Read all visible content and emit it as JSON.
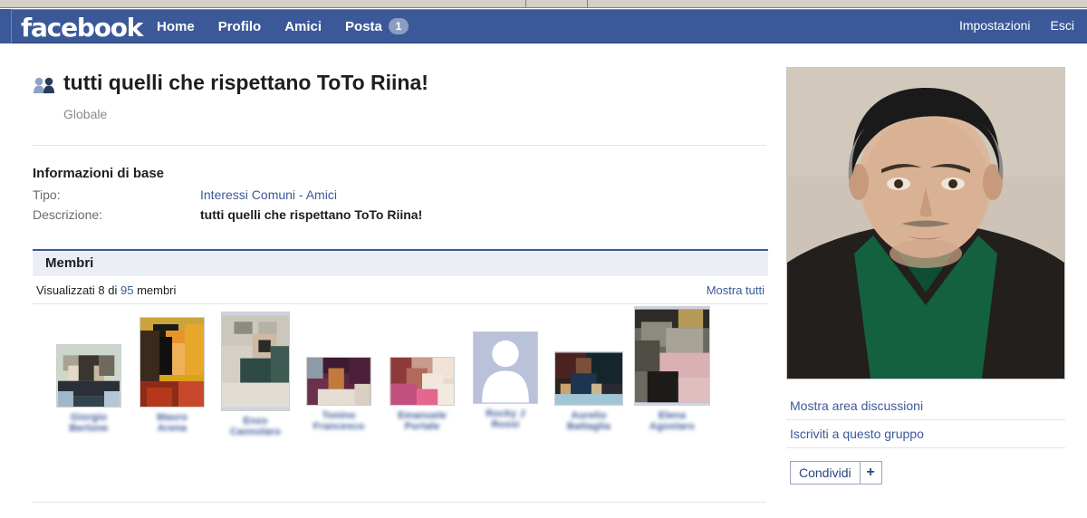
{
  "navbar": {
    "logo": "facebook",
    "links": [
      {
        "label": "Home",
        "name": "nav-home"
      },
      {
        "label": "Profilo",
        "name": "nav-profilo"
      },
      {
        "label": "Amici",
        "name": "nav-amici"
      }
    ],
    "posta": {
      "label": "Posta",
      "badge": "1"
    },
    "right_links": [
      {
        "label": "Impostazioni",
        "name": "nav-impostazioni"
      },
      {
        "label": "Esci",
        "name": "nav-esci"
      }
    ],
    "bg_color": "#3b5998"
  },
  "header": {
    "title": "tutti quelli che rispettano ToTo Riina!",
    "subtitle": "Globale",
    "icon": "group-people-icon"
  },
  "basic_info": {
    "section_title": "Informazioni di base",
    "rows": [
      {
        "label": "Tipo:",
        "value": "Interessi Comuni - Amici",
        "is_link": true
      },
      {
        "label": "Descrizione:",
        "value": "tutti quelli che rispettano ToTo Riina!",
        "is_link": false
      }
    ]
  },
  "members": {
    "section_title": "Membri",
    "count_prefix": "Visualizzati 8 di ",
    "count_number": "95",
    "count_suffix": " membri",
    "show_all_label": "Mostra tutti",
    "shown": 8,
    "total": 95,
    "list": [
      {
        "name_line1": "Giorgio",
        "name_line2": "Bertone",
        "has_photo": true
      },
      {
        "name_line1": "Mauro",
        "name_line2": "Arena",
        "has_photo": true
      },
      {
        "name_line1": "Enzo",
        "name_line2": "Cannolaro",
        "has_photo": true
      },
      {
        "name_line1": "Tonino",
        "name_line2": "Francesco",
        "has_photo": true
      },
      {
        "name_line1": "Emanuele",
        "name_line2": "Portale",
        "has_photo": true
      },
      {
        "name_line1": "Rocky J",
        "name_line2": "Rossi",
        "has_photo": false
      },
      {
        "name_line1": "Aurelio",
        "name_line2": "Battaglia",
        "has_photo": true
      },
      {
        "name_line1": "Elena",
        "name_line2": "Agostaro",
        "has_photo": true
      }
    ]
  },
  "sidebar": {
    "portrait_alt": "portrait-photo",
    "links": [
      {
        "label": "Mostra area discussioni",
        "name": "sidebar-link-discussioni"
      },
      {
        "label": "Iscriviti a questo gruppo",
        "name": "sidebar-link-iscriviti"
      }
    ],
    "share": {
      "label": "Condividi",
      "plus": "+"
    }
  },
  "colors": {
    "brand_blue": "#3b5998",
    "link_blue": "#3b5998",
    "section_bg": "#eceef5",
    "divider": "#e2e4e9"
  }
}
